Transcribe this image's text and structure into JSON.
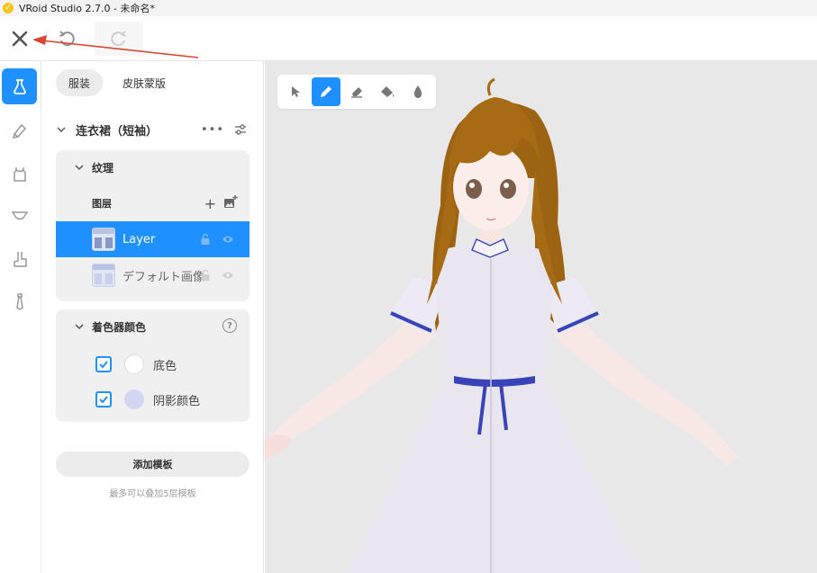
{
  "window": {
    "title": "VRoid Studio 2.7.0 - 未命名*"
  },
  "toolbar": {
    "close_icon": "close-icon",
    "undo_icon": "undo-icon",
    "redo_icon": "redo-icon"
  },
  "rail": {
    "items": [
      {
        "icon": "face-edit-icon",
        "active": true
      },
      {
        "icon": "hair-brush-icon",
        "active": false
      },
      {
        "icon": "top-clothing-icon",
        "active": false
      },
      {
        "icon": "bottom-clothing-icon",
        "active": false
      },
      {
        "icon": "shoe-icon",
        "active": false
      },
      {
        "icon": "accessory-icon",
        "active": false
      }
    ]
  },
  "panel": {
    "tabs": [
      {
        "label": "服装",
        "active": true
      },
      {
        "label": "皮肤蒙版",
        "active": false
      }
    ],
    "item_title": "连衣裙（短袖）",
    "more_label": "•••",
    "texture": {
      "section_label": "纹理",
      "layers_label": "图层",
      "add_label": "+",
      "layers": [
        {
          "name": "Layer",
          "selected": true
        },
        {
          "name": "デフォルト画像",
          "selected": false
        }
      ]
    },
    "shader": {
      "section_label": "着色器颜色",
      "help_label": "?",
      "colors": [
        {
          "label": "底色",
          "checked": true,
          "color": "#ffffff"
        },
        {
          "label": "阴影颜色",
          "checked": true,
          "color": "#d3d6f3"
        }
      ]
    },
    "add_template_label": "添加模板",
    "template_hint": "最多可以叠加5层模板"
  },
  "viewport": {
    "tools": [
      {
        "icon": "select-cursor-icon",
        "active": false
      },
      {
        "icon": "pencil-icon",
        "active": true
      },
      {
        "icon": "eraser-icon",
        "active": false
      },
      {
        "icon": "fill-icon",
        "active": false
      },
      {
        "icon": "blur-drop-icon",
        "active": false
      }
    ]
  },
  "colors": {
    "accent": "#1e90ff",
    "annotation_arrow": "#d9452f"
  }
}
